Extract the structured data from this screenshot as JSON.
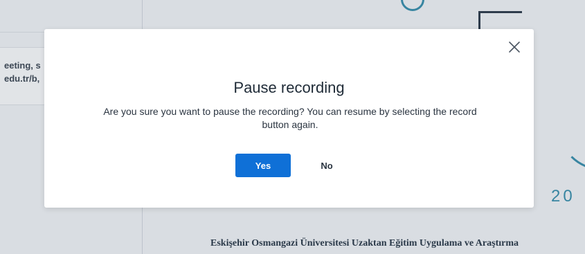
{
  "background": {
    "chat_lines": [
      "eeting, s",
      "edu.tr/b,"
    ],
    "slide_text": "Eskişehir Osmangazi Üniversitesi Uzaktan Eğitim Uygulama ve Araştırma",
    "slide_number": "20"
  },
  "modal": {
    "title": "Pause recording",
    "message": "Are you sure you want to pause the recording? You can resume by selecting the record button again.",
    "yes_label": "Yes",
    "no_label": "No",
    "close_icon": "close-icon"
  },
  "colors": {
    "primary": "#0f70d7",
    "modal_bg": "#ffffff",
    "page_bg": "#e9ecf0",
    "accent_teal": "#3a8daa"
  }
}
